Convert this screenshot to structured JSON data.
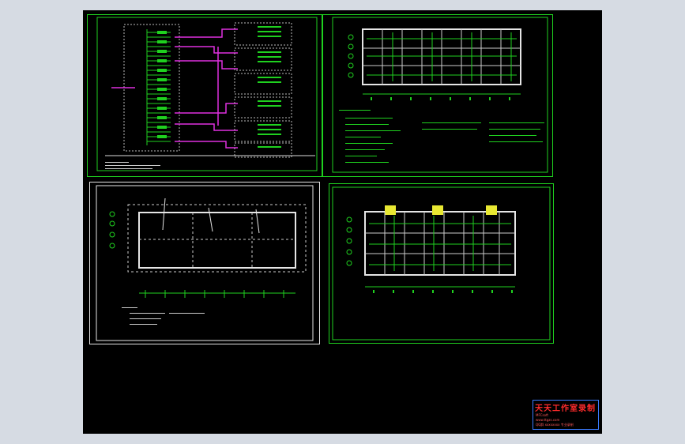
{
  "viewport": {
    "background": "#000000",
    "workspace_background": "#d6dbe3",
    "line_color_primary": "#1fd11f",
    "line_color_highlight": "#e030e0",
    "line_color_frame": "#e6e6e6"
  },
  "stamp": {
    "title": "天天工作室录制",
    "line1": "MFCsoft",
    "line2": "www.ttgzs.com",
    "line3": "QQ群 xxxxxxxx 专业录制"
  },
  "drawings": [
    {
      "id": "riser-diagram",
      "kind": "system-riser"
    },
    {
      "id": "floor-plan-top-right",
      "kind": "floor-plan"
    },
    {
      "id": "roof-plan",
      "kind": "roof-lightning-plan"
    },
    {
      "id": "floor-plan-bottom-right",
      "kind": "floor-plan"
    }
  ]
}
